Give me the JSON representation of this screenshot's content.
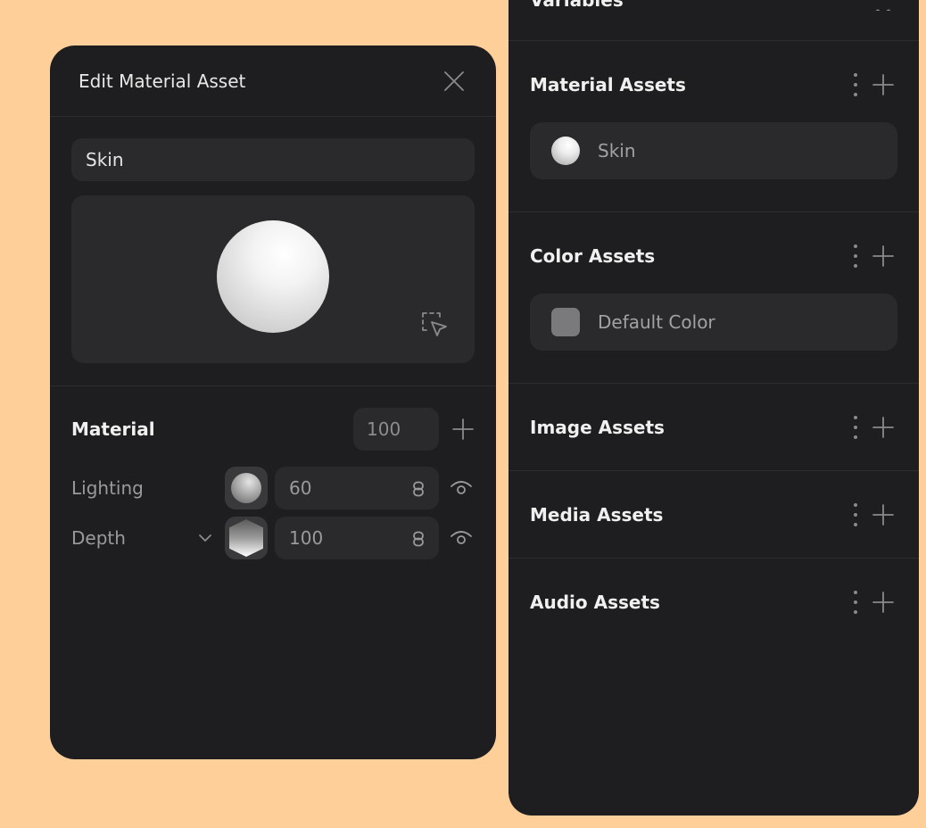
{
  "edit_panel": {
    "title": "Edit Material Asset",
    "name_value": "Skin",
    "material": {
      "label": "Material",
      "value": "100"
    },
    "properties": [
      {
        "label": "Lighting",
        "value": "60",
        "thumb": "sphere-icon"
      },
      {
        "label": "Depth",
        "value": "100",
        "thumb": "hexagon-icon",
        "has_dropdown": true
      }
    ]
  },
  "assets_panel": {
    "top_section_title": "Variables",
    "sections": [
      {
        "title": "Material Assets",
        "items": [
          {
            "label": "Skin",
            "icon": "sphere-icon"
          }
        ]
      },
      {
        "title": "Color Assets",
        "items": [
          {
            "label": "Default Color",
            "icon": "color-swatch",
            "color": "#7a797b"
          }
        ]
      },
      {
        "title": "Image Assets",
        "items": []
      },
      {
        "title": "Media Assets",
        "items": []
      },
      {
        "title": "Audio Assets",
        "items": []
      }
    ]
  },
  "colors": {
    "background": "#ffcf9a",
    "panel": "#1e1d1f",
    "field": "#2a292b",
    "text_primary": "#f0f0f0",
    "text_muted": "#9a999b"
  }
}
